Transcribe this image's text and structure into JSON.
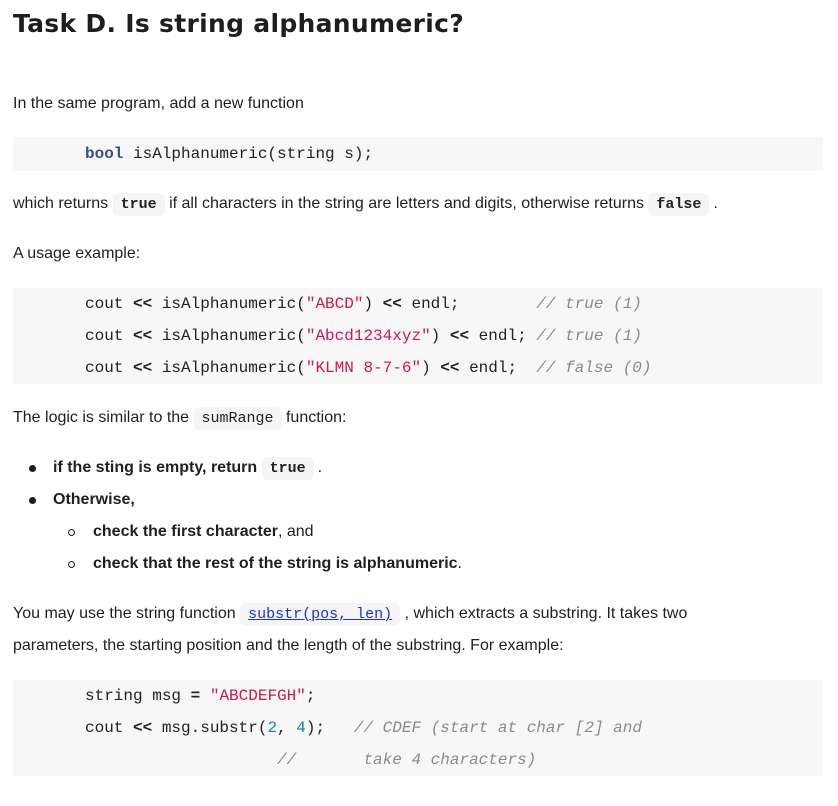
{
  "heading": "Task D. Is string alphanumeric?",
  "intro": "In the same program, add a new function",
  "signature": {
    "keyword": "bool",
    "rest": " isAlphanumeric(string s);"
  },
  "returns_sentence": {
    "before": "which returns",
    "true_code": "true",
    "middle": "if all characters in the string are letters and digits, otherwise returns",
    "false_code": "false",
    "after": "."
  },
  "usage_label": "A usage example:",
  "usage_lines": [
    {
      "pre": "cout ",
      "op1": "<<",
      "call": " isAlphanumeric(",
      "str": "\"ABCD\"",
      "close": ") ",
      "op2": "<<",
      "end": " endl;",
      "pad": "        ",
      "comment": "// true (1)"
    },
    {
      "pre": "cout ",
      "op1": "<<",
      "call": " isAlphanumeric(",
      "str": "\"Abcd1234xyz\"",
      "close": ") ",
      "op2": "<<",
      "end": " endl;",
      "pad": " ",
      "comment": "// true (1)"
    },
    {
      "pre": "cout ",
      "op1": "<<",
      "call": " isAlphanumeric(",
      "str": "\"KLMN 8-7-6\"",
      "close": ") ",
      "op2": "<<",
      "end": " endl;",
      "pad": "  ",
      "comment": "// false (0)"
    }
  ],
  "logic": {
    "before": "The logic is similar to the",
    "code": "sumRange",
    "after": "function:"
  },
  "bullets": [
    {
      "bold": "if the sting is empty, return",
      "code": "true",
      "after": "."
    },
    {
      "bold": "Otherwise,"
    }
  ],
  "sub_bullets": [
    {
      "bold": "check the first character",
      "after": ", and"
    },
    {
      "bold": "check that the rest of the string is alphanumeric",
      "after": "."
    }
  ],
  "substr_para": {
    "before": "You may use the string function",
    "link": "substr(pos, len)",
    "after": ", which extracts a substring. It takes two",
    "line2": "parameters, the starting position and the length of the substring. For example:"
  },
  "example": {
    "line1": {
      "text": "string msg ",
      "op": "=",
      "sp": " ",
      "str": "\"ABCDEFGH\"",
      "end": ";"
    },
    "line2": {
      "pre": "cout ",
      "op": "<<",
      "call": " msg.substr(",
      "n1": "2",
      "sep": ", ",
      "n2": "4",
      "end": ");",
      "pad": "   ",
      "comment": "// CDEF (start at char [2] and"
    },
    "line3": {
      "pad": "                    ",
      "comment": "//       take 4 characters)"
    }
  }
}
